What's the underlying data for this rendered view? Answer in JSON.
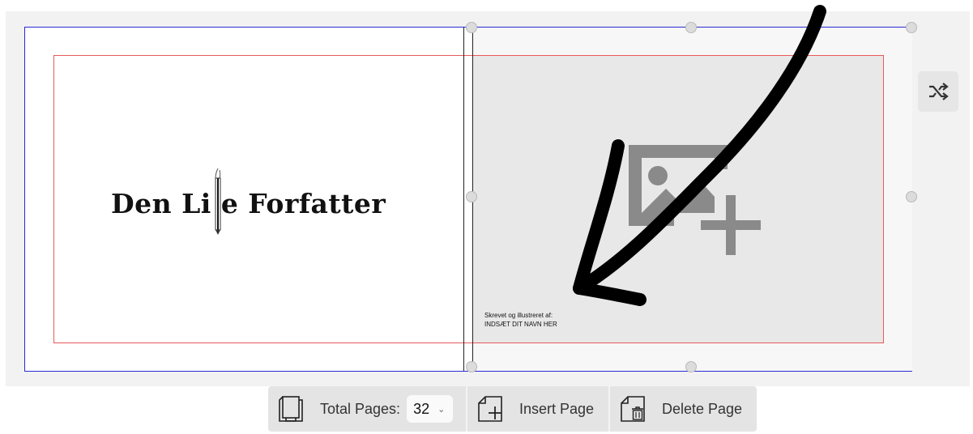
{
  "book": {
    "title_text": "Den Li e Forfatter",
    "byline_line1": "Skrevet og illustreret af:",
    "byline_line2": "INDSÆT DIT NAVN HER"
  },
  "toolbar": {
    "total_pages_label": "Total Pages:",
    "total_pages_value": "32",
    "insert_label": "Insert Page",
    "delete_label": "Delete Page"
  },
  "icons": {
    "shuffle": "shuffle-icon",
    "image_add": "image-add-icon",
    "pages": "pages-stack-icon",
    "insert": "insert-page-icon",
    "delete": "delete-page-icon",
    "arrow": "hand-drawn-arrow"
  },
  "colors": {
    "bleed_border": "#2a2ad6",
    "safe_zone": "#e85a5a",
    "placeholder_gray": "#8a8a8a",
    "toolbar_bg": "#e4e4e4"
  }
}
